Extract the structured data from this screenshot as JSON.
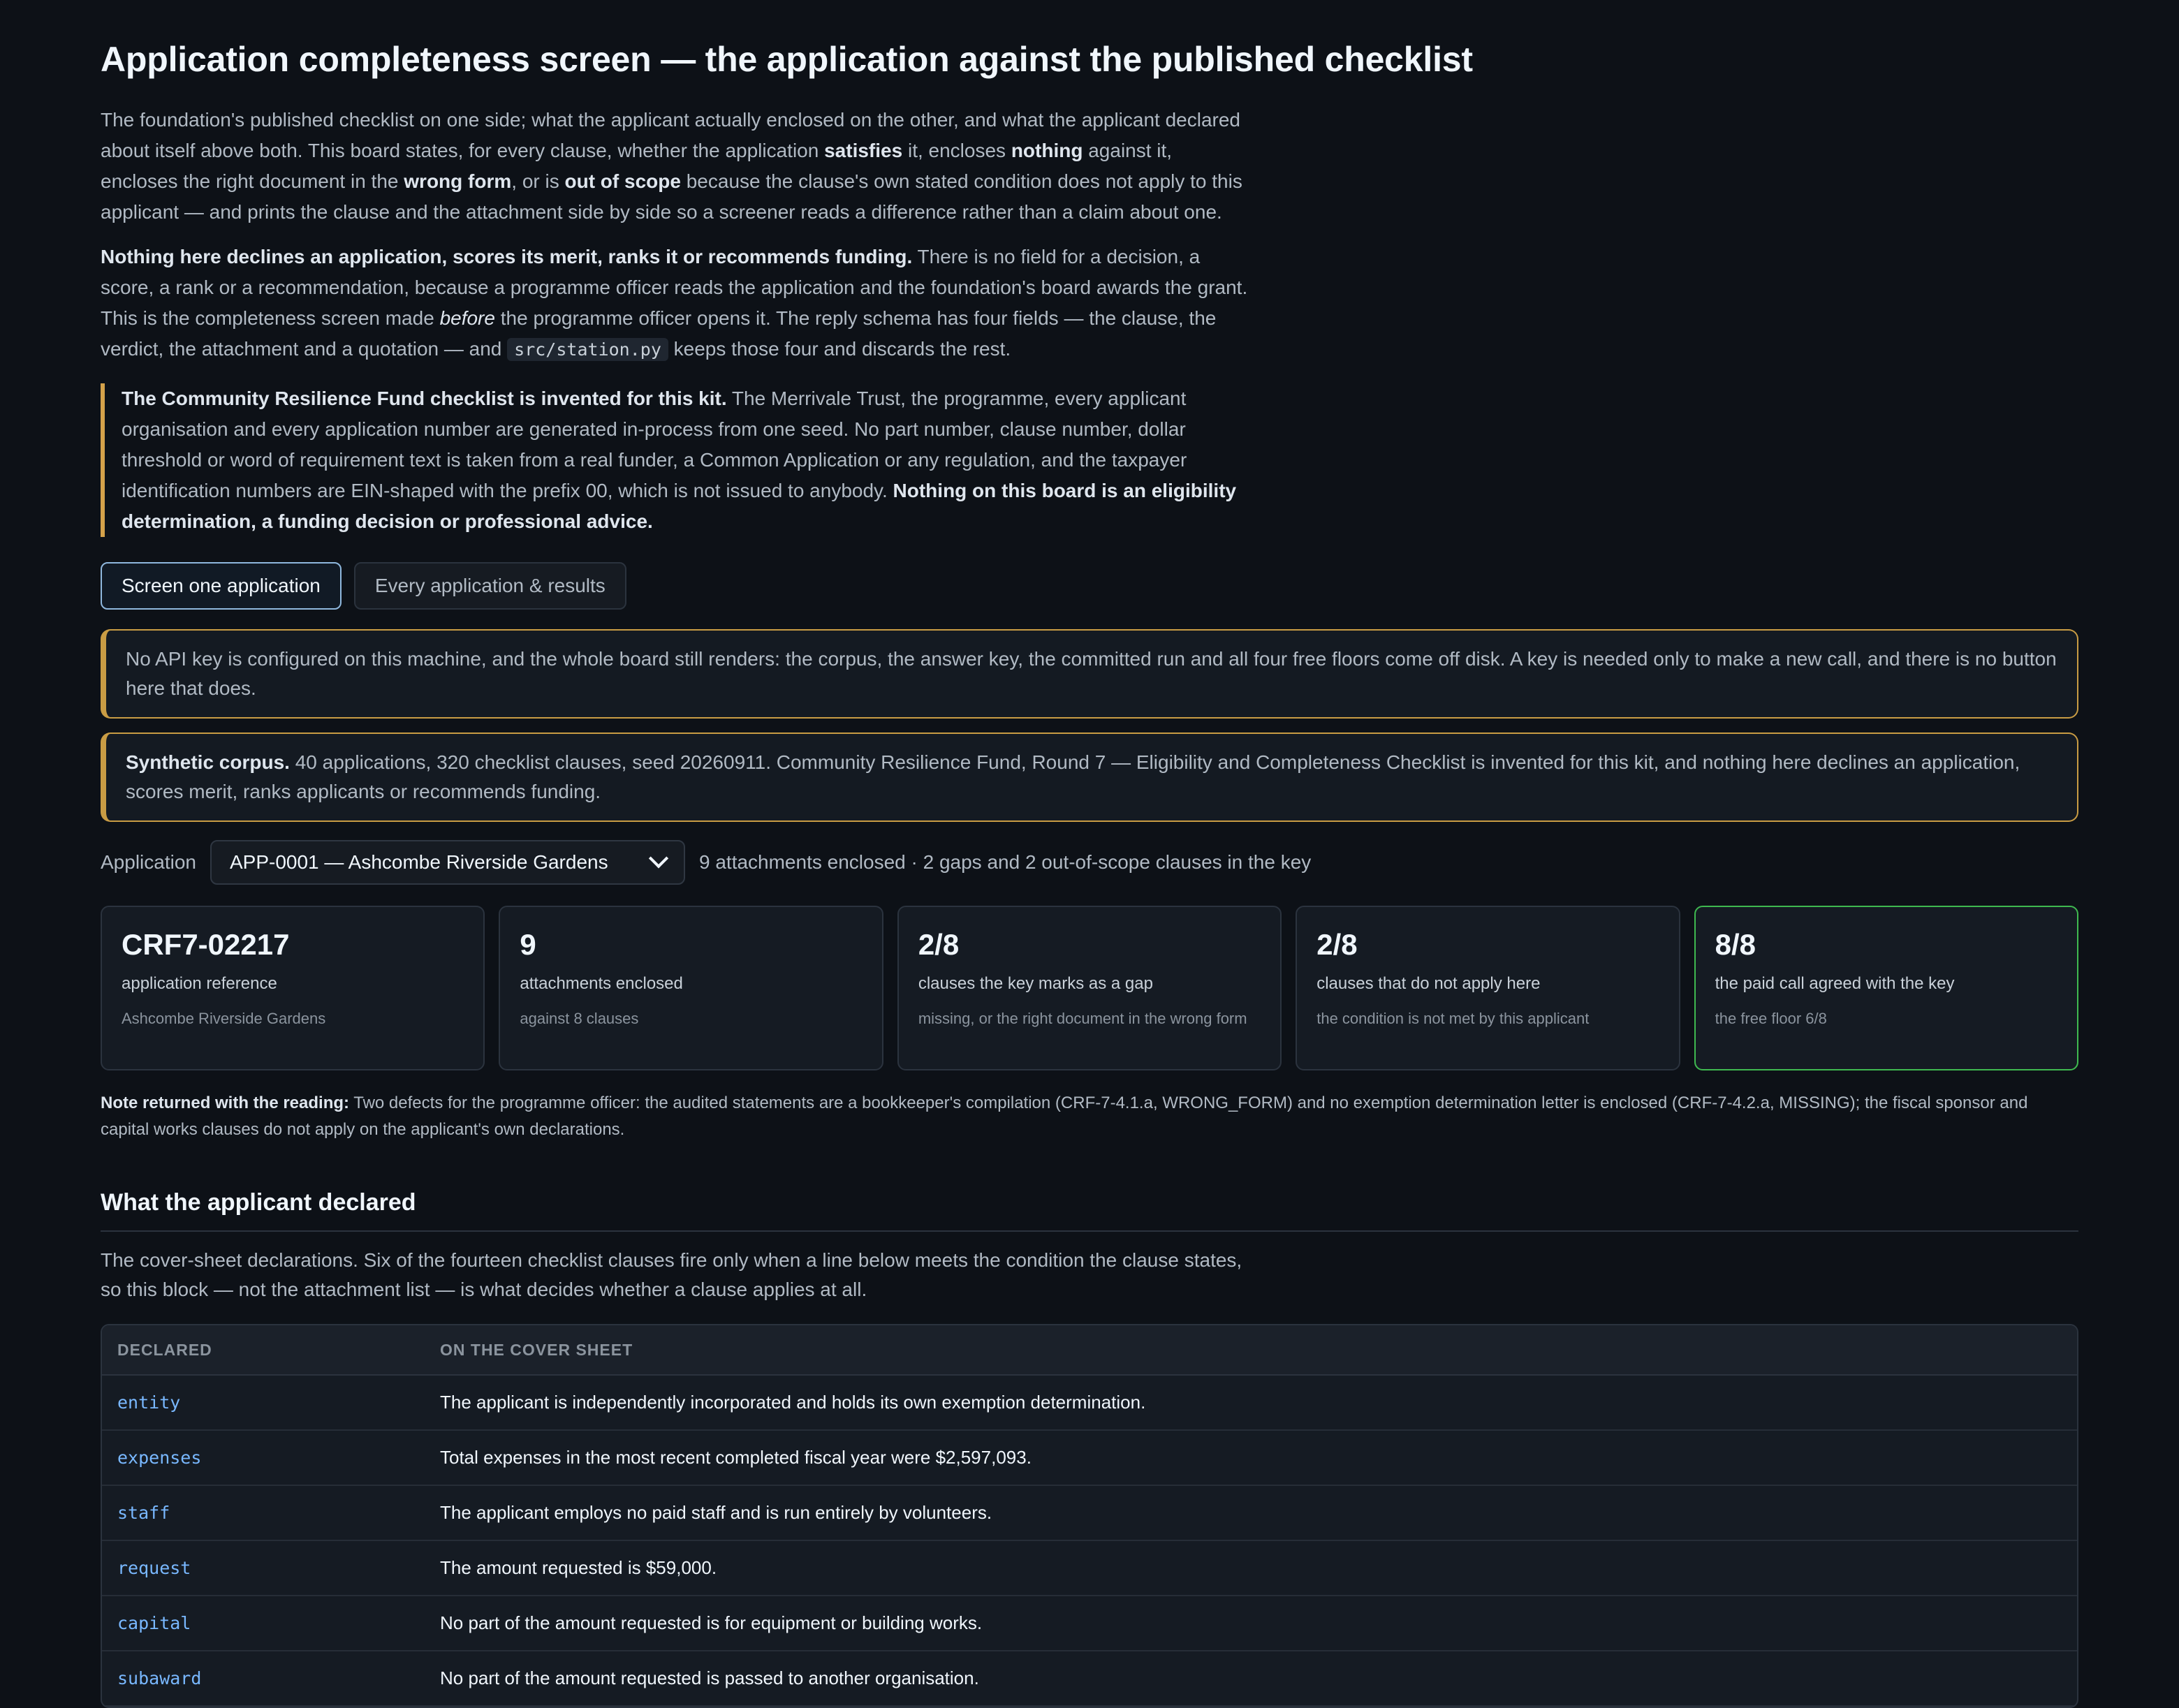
{
  "title": "Application completeness screen — the application against the published checklist",
  "lede1": {
    "t1": "The foundation's published checklist on one side; what the applicant actually enclosed on the other, and what the applicant declared about itself above both. This board states, for every clause, whether the application ",
    "b1": "satisfies",
    "t2": " it, encloses ",
    "b2": "nothing",
    "t3": " against it, encloses the right document in the ",
    "b3": "wrong form",
    "t4": ", or is ",
    "b4": "out of scope",
    "t5": " because the clause's own stated condition does not apply to this applicant — and prints the clause and the attachment side by side so a screener reads a difference rather than a claim about one."
  },
  "lede2": {
    "b1": "Nothing here declines an application, scores its merit, ranks it or recommends funding.",
    "t1": " There is no field for a decision, a score, a rank or a recommendation, because a programme officer reads the application and the foundation's board awards the grant. This is the completeness screen made ",
    "i1": "before",
    "t2": " the programme officer opens it. The reply schema has four fields — the clause, the verdict, the attachment and a quotation — and ",
    "code": "src/station.py",
    "t3": " keeps those four and discards the rest."
  },
  "quote": {
    "b1": "The Community Resilience Fund checklist is invented for this kit.",
    "t1": " The Merrivale Trust, the programme, every applicant organisation and every application number are generated in-process from one seed. No part number, clause number, dollar threshold or word of requirement text is taken from a real funder, a Common Application or any regulation, and the taxpayer identification numbers are EIN-shaped with the prefix 00, which is not issued to anybody. ",
    "b2": "Nothing on this board is an eligibility determination, a funding decision or professional advice."
  },
  "tabs": [
    "Screen one application",
    "Every application & results"
  ],
  "notice_api": "No API key is configured on this machine, and the whole board still renders: the corpus, the answer key, the committed run and all four free floors come off disk. A key is needed only to make a new call, and there is no button here that does.",
  "notice_corpus": {
    "b": "Synthetic corpus.",
    "t": " 40 applications, 320 checklist clauses, seed 20260911. Community Resilience Fund, Round 7 — Eligibility and Completeness Checklist is invented for this kit, and nothing here declines an application, scores merit, ranks applicants or recommends funding."
  },
  "application": {
    "label": "Application",
    "selected": "APP-0001 — Ashcombe Riverside Gardens",
    "meta": "9 attachments enclosed · 2 gaps and 2 out-of-scope clauses in the key"
  },
  "cards": [
    {
      "big": "CRF7-02217",
      "cap": "application reference",
      "sub": "Ashcombe Riverside Gardens"
    },
    {
      "big": "9",
      "cap": "attachments enclosed",
      "sub": "against 8 clauses"
    },
    {
      "big": "2/8",
      "cap": "clauses the key marks as a gap",
      "sub": "missing, or the right document in the wrong form"
    },
    {
      "big": "2/8",
      "cap": "clauses that do not apply here",
      "sub": "the condition is not met by this applicant"
    },
    {
      "big": "8/8",
      "cap": "the paid call agreed with the key",
      "sub": "the free floor 6/8"
    }
  ],
  "note": {
    "b": "Note returned with the reading:",
    "t": " Two defects for the programme officer: the audited statements are a bookkeeper's compilation (CRF-7-4.1.a, WRONG_FORM) and no exemption determination letter is enclosed (CRF-7-4.2.a, MISSING); the fiscal sponsor and capital works clauses do not apply on the applicant's own declarations."
  },
  "declared": {
    "heading": "What the applicant declared",
    "intro": "The cover-sheet declarations. Six of the fourteen checklist clauses fire only when a line below meets the condition the clause states, so this block — not the attachment list — is what decides whether a clause applies at all.",
    "headers": [
      "Declared",
      "On the cover sheet"
    ],
    "rows": [
      {
        "k": "entity",
        "v": "The applicant is independently incorporated and holds its own exemption determination."
      },
      {
        "k": "expenses",
        "v": "Total expenses in the most recent completed fiscal year were $2,597,093."
      },
      {
        "k": "staff",
        "v": "The applicant employs no paid staff and is run entirely by volunteers."
      },
      {
        "k": "request",
        "v": "The amount requested is $59,000."
      },
      {
        "k": "capital",
        "v": "No part of the amount requested is for equipment or building works."
      },
      {
        "k": "subaward",
        "v": "No part of the amount requested is passed to another organisation."
      }
    ]
  }
}
